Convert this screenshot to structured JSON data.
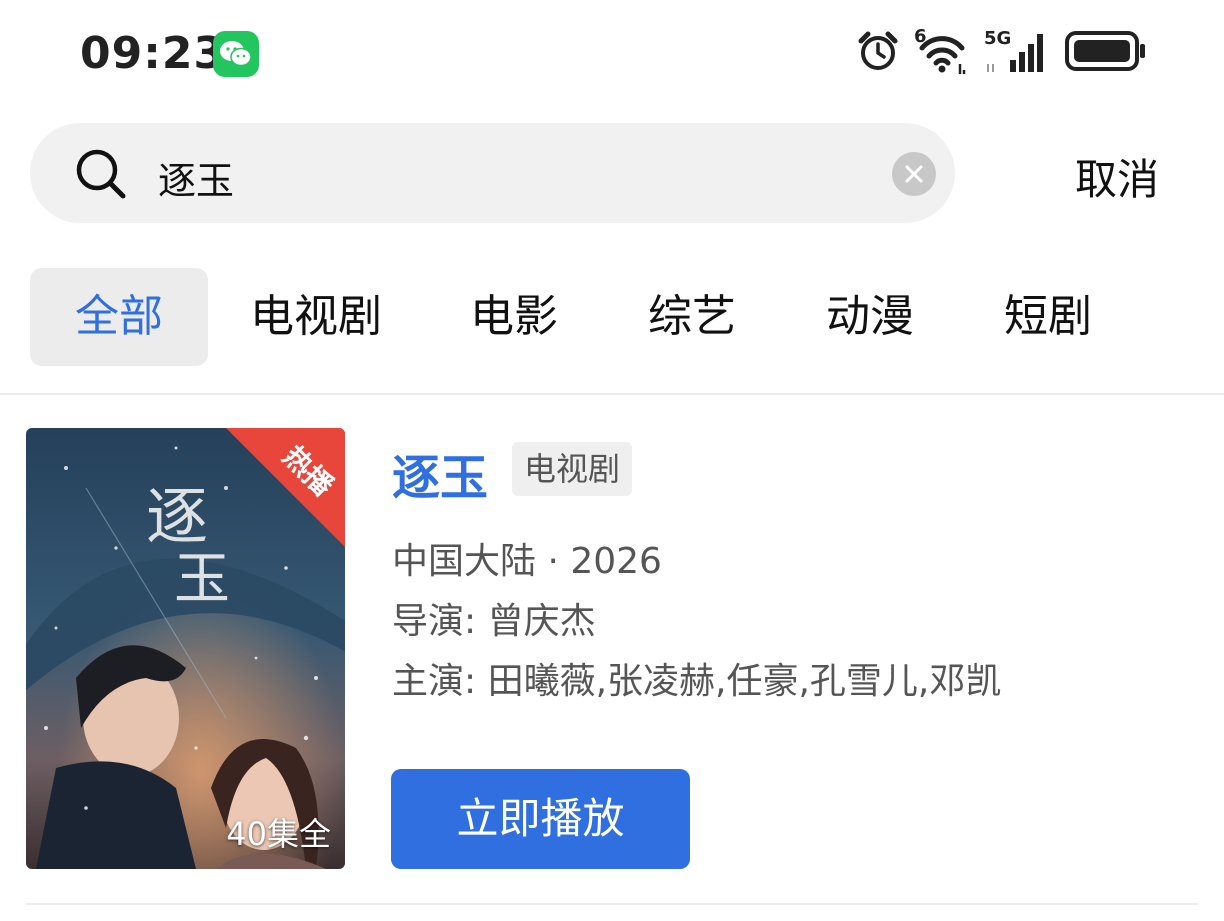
{
  "status_bar": {
    "time": "09:23",
    "wifi_label": "6",
    "network_label": "5G",
    "icons": [
      "wechat-icon",
      "alarm-icon",
      "wifi-icon",
      "signal-icon",
      "battery-icon"
    ]
  },
  "search": {
    "query": "逐玉",
    "cancel_label": "取消"
  },
  "tabs": [
    {
      "label": "全部",
      "active": true
    },
    {
      "label": "电视剧",
      "active": false
    },
    {
      "label": "电影",
      "active": false
    },
    {
      "label": "综艺",
      "active": false
    },
    {
      "label": "动漫",
      "active": false
    },
    {
      "label": "短剧",
      "active": false
    }
  ],
  "result": {
    "title": "逐玉",
    "type": "电视剧",
    "region_year": "中国大陆 · 2026",
    "director": "导演:  曾庆杰",
    "cast": "主演:  田曦薇,张凌赫,任豪,孔雪儿,邓凯",
    "hot_badge": "热播",
    "episodes": "40集全",
    "play_label": "立即播放"
  },
  "colors": {
    "accent": "#2f6fe0",
    "hot_badge": "#e8463a",
    "wechat": "#22c55e"
  }
}
